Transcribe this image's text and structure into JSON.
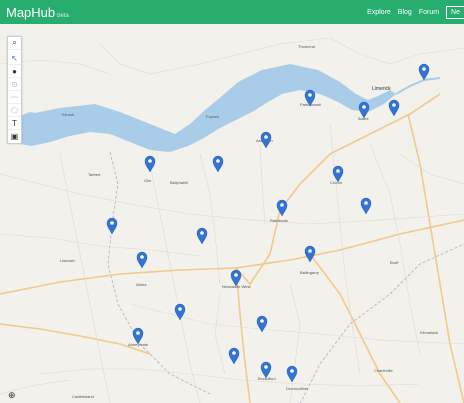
{
  "app": {
    "name": "MapHub",
    "badge": "beta"
  },
  "nav": {
    "items": [
      "Explore",
      "Blog",
      "Forum"
    ],
    "new_label": "Ne"
  },
  "toolbar": {
    "tools": [
      {
        "name": "search-icon",
        "glyph": "⌕",
        "interactable": true,
        "state": "normal"
      },
      {
        "name": "cursor-icon",
        "glyph": "↖",
        "interactable": true,
        "state": "active"
      },
      {
        "name": "marker-tool-icon",
        "glyph": "●",
        "interactable": true,
        "state": "normal"
      },
      {
        "name": "pin-tool-icon",
        "glyph": "⊙",
        "interactable": true,
        "state": "dim"
      },
      {
        "name": "line-tool-icon",
        "glyph": "〰",
        "interactable": true,
        "state": "dim"
      },
      {
        "name": "polygon-tool-icon",
        "glyph": "⬡",
        "interactable": true,
        "state": "dim"
      },
      {
        "name": "text-tool-icon",
        "glyph": "T",
        "interactable": true,
        "state": "normal"
      },
      {
        "name": "image-tool-icon",
        "glyph": "▣",
        "interactable": true,
        "state": "normal"
      }
    ]
  },
  "locate_glyph": "⊕",
  "places": [
    {
      "name": "Thomond",
      "big": false
    },
    {
      "name": "Limerick",
      "big": true
    },
    {
      "name": "Kilrush",
      "big": false
    },
    {
      "name": "Tarbert",
      "big": false
    },
    {
      "name": "Foynes",
      "big": false
    },
    {
      "name": "Askeaton",
      "big": false
    },
    {
      "name": "Patrickswell",
      "big": false
    },
    {
      "name": "Adare",
      "big": false
    },
    {
      "name": "Croom",
      "big": false
    },
    {
      "name": "Rathkeale",
      "big": false
    },
    {
      "name": "Ballingarry",
      "big": false
    },
    {
      "name": "Newcastle West",
      "big": false
    },
    {
      "name": "Abbeyfeale",
      "big": false
    },
    {
      "name": "Dromcolliher",
      "big": false
    },
    {
      "name": "Broadford",
      "big": false
    },
    {
      "name": "Castleisland",
      "big": false
    },
    {
      "name": "Listowel",
      "big": false
    },
    {
      "name": "Charleville",
      "big": false
    },
    {
      "name": "Kilmallock",
      "big": false
    },
    {
      "name": "Bruff",
      "big": false
    },
    {
      "name": "Glin",
      "big": false
    },
    {
      "name": "Athea",
      "big": false
    },
    {
      "name": "Ballyhahill",
      "big": false
    }
  ],
  "markers_count": 21
}
